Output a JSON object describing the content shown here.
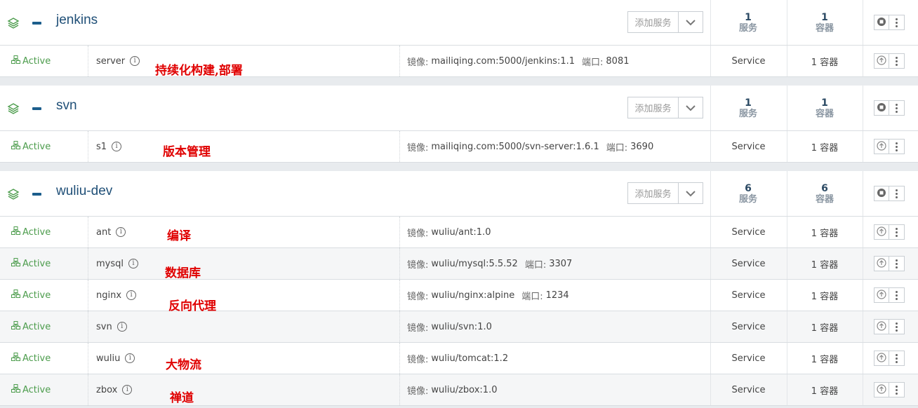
{
  "add_service_label": "添加服务",
  "state_label": "Active",
  "image_prefix": "镜像:",
  "port_prefix": "端口:",
  "stacks": [
    {
      "name": "jenkins",
      "service_count": "1",
      "service_count_label": "服务",
      "container_count": "1",
      "container_count_label": "容器",
      "services": [
        {
          "name": "server",
          "image": "mailiqing.com:5000/jenkins:1.1",
          "port": "8081",
          "type": "Service",
          "containers": "1 容器",
          "annotation": "持续化构建,部署"
        }
      ]
    },
    {
      "name": "svn",
      "service_count": "1",
      "service_count_label": "服务",
      "container_count": "1",
      "container_count_label": "容器",
      "services": [
        {
          "name": "s1",
          "image": "mailiqing.com:5000/svn-server:1.6.1",
          "port": "3690",
          "type": "Service",
          "containers": "1 容器",
          "annotation": "版本管理"
        }
      ]
    },
    {
      "name": "wuliu-dev",
      "service_count": "6",
      "service_count_label": "服务",
      "container_count": "6",
      "container_count_label": "容器",
      "services": [
        {
          "name": "ant",
          "image": "wuliu/ant:1.0",
          "port": "",
          "type": "Service",
          "containers": "1 容器",
          "annotation": "编译"
        },
        {
          "name": "mysql",
          "image": "wuliu/mysql:5.5.52",
          "port": "3307",
          "type": "Service",
          "containers": "1 容器",
          "annotation": "数据库"
        },
        {
          "name": "nginx",
          "image": "wuliu/nginx:alpine",
          "port": "1234",
          "type": "Service",
          "containers": "1 容器",
          "annotation": "反向代理"
        },
        {
          "name": "svn",
          "image": "wuliu/svn:1.0",
          "port": "",
          "type": "Service",
          "containers": "1 容器",
          "annotation": ""
        },
        {
          "name": "wuliu",
          "image": "wuliu/tomcat:1.2",
          "port": "",
          "type": "Service",
          "containers": "1 容器",
          "annotation": "大物流"
        },
        {
          "name": "zbox",
          "image": "wuliu/zbox:1.0",
          "port": "",
          "type": "Service",
          "containers": "1 容器",
          "annotation": "禅道"
        }
      ]
    }
  ]
}
